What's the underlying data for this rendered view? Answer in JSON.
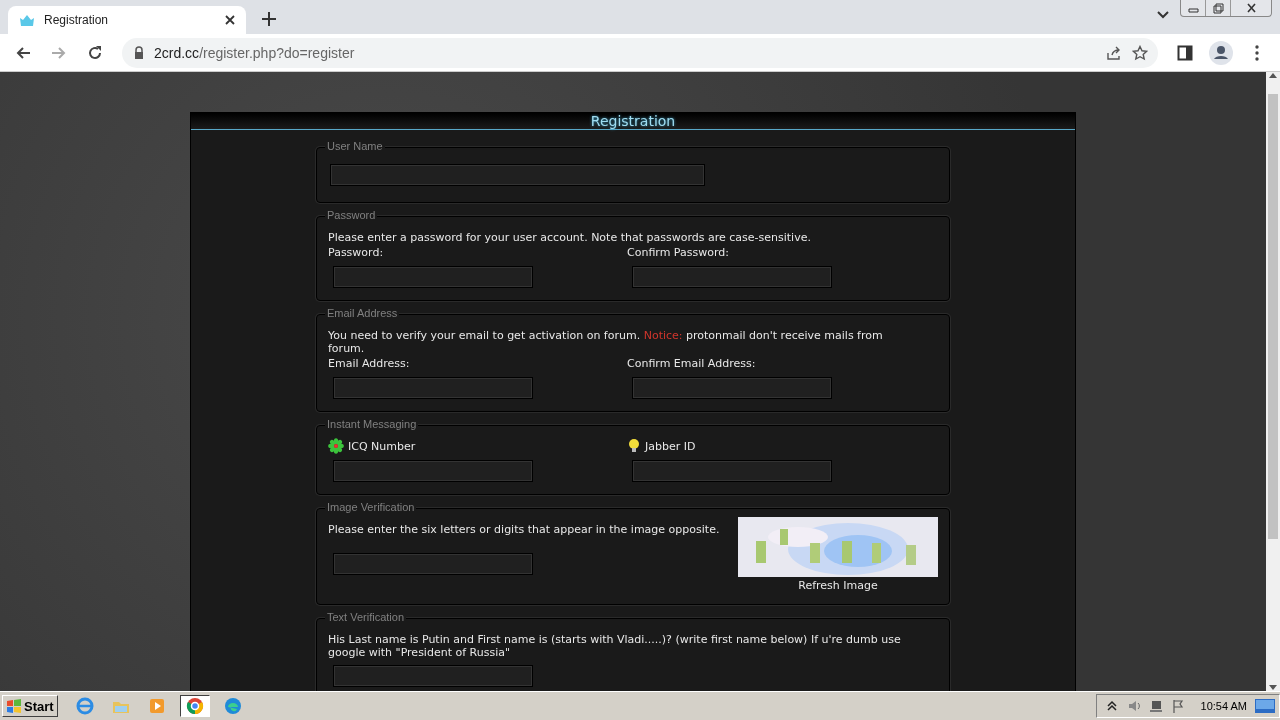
{
  "browser": {
    "tab": {
      "title": "Registration"
    },
    "url": {
      "host": "2crd.cc",
      "path": "/register.php?do=register"
    }
  },
  "page": {
    "title": "Registration",
    "sections": [
      {
        "kind": "username",
        "legend": "User Name"
      },
      {
        "kind": "pair",
        "legend": "Password",
        "note": "Please enter a password for your user account. Note that passwords are case-sensitive.",
        "fields": [
          {
            "label": "Password:"
          },
          {
            "label": "Confirm Password:"
          }
        ]
      },
      {
        "kind": "pair",
        "legend": "Email Address",
        "note": "You need to verify your email to get activation on forum.",
        "notice_label": "Notice:",
        "notice": "protonmail don't receive mails from forum.",
        "fields": [
          {
            "label": "Email Address:"
          },
          {
            "label": "Confirm Email Address:"
          }
        ]
      },
      {
        "kind": "messaging",
        "legend": "Instant Messaging",
        "fields": [
          {
            "label": "ICQ Number"
          },
          {
            "label": "Jabber ID"
          }
        ]
      },
      {
        "kind": "captcha",
        "legend": "Image Verification",
        "note": "Please enter the six letters or digits that appear in the image opposite.",
        "link": "Refresh Image"
      },
      {
        "kind": "question",
        "legend": "Text Verification",
        "note": "His Last name is Putin and First name is (starts with Vladi.....)? (write first name below) If u're dumb use google with \"President of Russia\""
      }
    ]
  },
  "taskbar": {
    "start": "Start",
    "clock": "10:54 AM"
  }
}
